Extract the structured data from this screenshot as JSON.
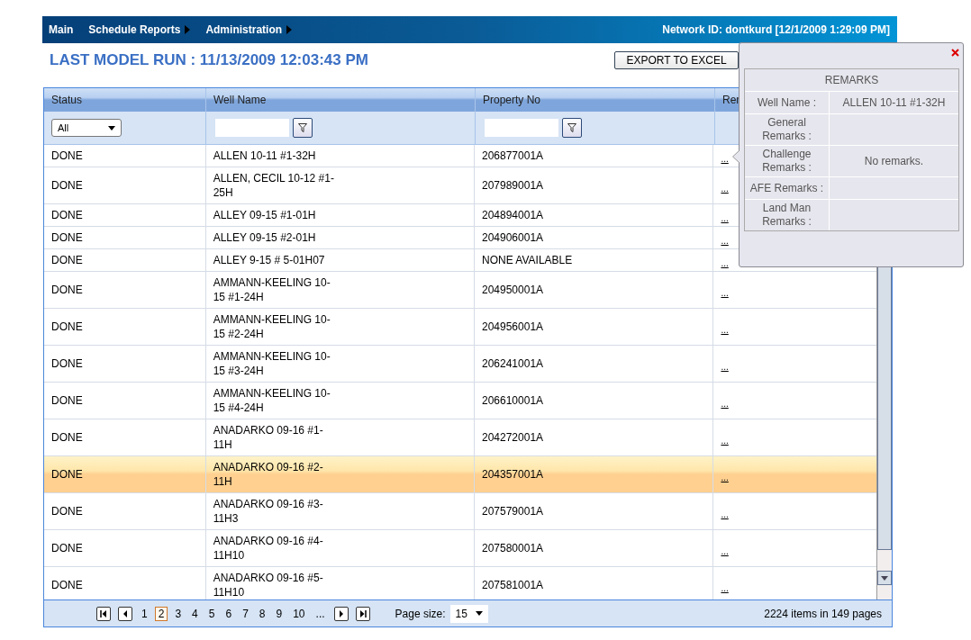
{
  "nav": {
    "items": [
      {
        "label": "Main",
        "has_submenu": false
      },
      {
        "label": "Schedule Reports",
        "has_submenu": true
      },
      {
        "label": "Administration",
        "has_submenu": true
      }
    ],
    "network_id": "Network ID: dontkurd [12/1/2009 1:29:09 PM]"
  },
  "title": "LAST MODEL RUN : 11/13/2009 12:03:43 PM",
  "export_button": "EXPORT TO EXCEL",
  "table": {
    "columns": [
      {
        "label": "Status",
        "kind": "select",
        "value": "All"
      },
      {
        "label": "Well Name",
        "kind": "text"
      },
      {
        "label": "Property No",
        "kind": "text"
      },
      {
        "label": "Rer",
        "kind": "none"
      }
    ],
    "rows": [
      {
        "status": "DONE",
        "well": "ALLEN 10-11 #1-32H",
        "property": "206877001A",
        "remarks": "...",
        "selected": false
      },
      {
        "status": "DONE",
        "well": "ALLEN, CECIL 10-12 #1-25H",
        "property": "207989001A",
        "remarks": "...",
        "selected": false
      },
      {
        "status": "DONE",
        "well": "ALLEY 09-15 #1-01H",
        "property": "204894001A",
        "remarks": "...",
        "selected": false
      },
      {
        "status": "DONE",
        "well": "ALLEY 09-15 #2-01H",
        "property": "204906001A",
        "remarks": "...",
        "selected": false
      },
      {
        "status": "DONE",
        "well": "ALLEY 9-15 # 5-01H07",
        "property": "NONE AVAILABLE",
        "remarks": "...",
        "selected": false
      },
      {
        "status": "DONE",
        "well": "AMMANN-KEELING 10-15 #1-24H",
        "property": "204950001A",
        "remarks": "...",
        "selected": false
      },
      {
        "status": "DONE",
        "well": "AMMANN-KEELING 10-15 #2-24H",
        "property": "204956001A",
        "remarks": "...",
        "selected": false
      },
      {
        "status": "DONE",
        "well": "AMMANN-KEELING 10-15 #3-24H",
        "property": "206241001A",
        "remarks": "...",
        "selected": false
      },
      {
        "status": "DONE",
        "well": "AMMANN-KEELING 10-15 #4-24H",
        "property": "206610001A",
        "remarks": "...",
        "selected": false
      },
      {
        "status": "DONE",
        "well": "ANADARKO 09-16 #1-11H",
        "property": "204272001A",
        "remarks": "...",
        "selected": false
      },
      {
        "status": "DONE",
        "well": "ANADARKO 09-16 #2-11H",
        "property": "204357001A",
        "remarks": "...",
        "selected": true
      },
      {
        "status": "DONE",
        "well": "ANADARKO 09-16 #3-11H3",
        "property": "207579001A",
        "remarks": "...",
        "selected": false
      },
      {
        "status": "DONE",
        "well": "ANADARKO 09-16 #4-11H10",
        "property": "207580001A",
        "remarks": "...",
        "selected": false
      },
      {
        "status": "DONE",
        "well": "ANADARKO 09-16 #5-11H10",
        "property": "207581001A",
        "remarks": "...",
        "selected": false
      }
    ]
  },
  "pager": {
    "pages": [
      {
        "label": "1",
        "selected": false
      },
      {
        "label": "2",
        "selected": true
      },
      {
        "label": "3",
        "selected": false
      },
      {
        "label": "4",
        "selected": false
      },
      {
        "label": "5",
        "selected": false
      },
      {
        "label": "6",
        "selected": false
      },
      {
        "label": "7",
        "selected": false
      },
      {
        "label": "8",
        "selected": false
      },
      {
        "label": "9",
        "selected": false
      },
      {
        "label": "10",
        "selected": false
      },
      {
        "label": "...",
        "selected": false
      }
    ],
    "page_size_label": "Page size:",
    "page_size": "15",
    "summary": "2224 items in 149 pages"
  },
  "remarks_popup": {
    "title": "REMARKS",
    "fields": [
      {
        "label": "Well Name :",
        "value": "ALLEN 10-11 #1-32H"
      },
      {
        "label": "General Remarks :"
      },
      {
        "label": "Challenge Remarks :",
        "value": "No remarks."
      },
      {
        "label": "AFE Remarks :"
      },
      {
        "label": "Land Man Remarks :"
      }
    ]
  }
}
